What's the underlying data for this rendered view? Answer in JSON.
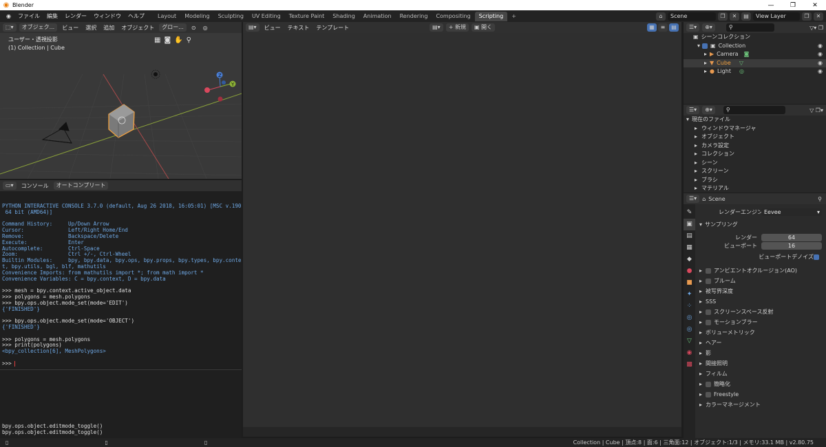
{
  "window": {
    "title": "Blender",
    "minimize": "—",
    "maximize": "❐",
    "close": "✕"
  },
  "menu": [
    "ファイル",
    "編集",
    "レンダー",
    "ウィンドウ",
    "ヘルプ"
  ],
  "workspace_tabs": [
    "Layout",
    "Modeling",
    "Sculpting",
    "UV Editing",
    "Texture Paint",
    "Shading",
    "Animation",
    "Rendering",
    "Compositing",
    "Scripting"
  ],
  "active_tab": "Scripting",
  "scene": {
    "name": "Scene",
    "view_layer": "View Layer"
  },
  "viewport": {
    "header": {
      "mode": "オブジェク...",
      "view": "ビュー",
      "select": "選択",
      "add": "追加",
      "object": "オブジェクト",
      "transform": "グロー..."
    },
    "label_view": "ユーザー・透視投影",
    "label_obj": "(1) Collection | Cube",
    "gizmo": {
      "x": "X",
      "y": "Y",
      "z": "Z"
    }
  },
  "console": {
    "header": {
      "console": "コンソール",
      "autocomplete": "オートコンプリート"
    },
    "lines": [
      {
        "t": "info",
        "s": "PYTHON INTERACTIVE CONSOLE 3.7.0 (default, Aug 26 2018, 16:05:01) [MSC v.1900"
      },
      {
        "t": "info",
        "s": " 64 bit (AMD64)]"
      },
      {
        "t": "blank",
        "s": ""
      },
      {
        "t": "info",
        "s": "Command History:     Up/Down Arrow"
      },
      {
        "t": "info",
        "s": "Cursor:              Left/Right Home/End"
      },
      {
        "t": "info",
        "s": "Remove:              Backspace/Delete"
      },
      {
        "t": "info",
        "s": "Execute:             Enter"
      },
      {
        "t": "info",
        "s": "Autocomplete:        Ctrl-Space"
      },
      {
        "t": "info",
        "s": "Zoom:                Ctrl +/-, Ctrl-Wheel"
      },
      {
        "t": "info",
        "s": "Builtin Modules:     bpy, bpy.data, bpy.ops, bpy.props, bpy.types, bpy.contex"
      },
      {
        "t": "info",
        "s": "t, bpy.utils, bgl, blf, mathutils"
      },
      {
        "t": "info",
        "s": "Convenience Imports: from mathutils import *; from math import *"
      },
      {
        "t": "info",
        "s": "Convenience Variables: C = bpy.context, D = bpy.data"
      },
      {
        "t": "blank",
        "s": ""
      },
      {
        "t": "cmd",
        "s": ">>> mesh = bpy.context.active_object.data"
      },
      {
        "t": "cmd",
        "s": ">>> polygons = mesh.polygons"
      },
      {
        "t": "cmd",
        "s": ">>> bpy.ops.object.mode_set(mode='EDIT')"
      },
      {
        "t": "res",
        "s": "{'FINISHED'}"
      },
      {
        "t": "blank",
        "s": ""
      },
      {
        "t": "cmd",
        "s": ">>> bpy.ops.object.mode_set(mode='OBJECT')"
      },
      {
        "t": "res",
        "s": "{'FINISHED'}"
      },
      {
        "t": "blank",
        "s": ""
      },
      {
        "t": "cmd",
        "s": ">>> polygons = mesh.polygons"
      },
      {
        "t": "cmd",
        "s": ">>> print(polygons)"
      },
      {
        "t": "res",
        "s": "<bpy_collection[6], MeshPolygons>"
      },
      {
        "t": "blank",
        "s": ""
      },
      {
        "t": "cmd",
        "s": ">>> "
      }
    ]
  },
  "info_log": [
    "bpy.ops.object.editmode_toggle()",
    "bpy.ops.object.editmode_toggle()"
  ],
  "text_editor": {
    "view": "ビュー",
    "text": "テキスト",
    "template": "テンプレート",
    "new": "新規",
    "open": "開く"
  },
  "outliner": {
    "root": "シーンコレクション",
    "collection": "Collection",
    "items": [
      "Camera",
      "Cube",
      "Light"
    ]
  },
  "filebrowser": {
    "root": "現在のファイル",
    "items": [
      "ウィンドウマネージャ",
      "オブジェクト",
      "カメラ設定",
      "コレクション",
      "シーン",
      "スクリーン",
      "ブラシ",
      "マテリアル"
    ]
  },
  "properties": {
    "scene": "Scene",
    "engine_label": "レンダーエンジン",
    "engine": "Eevee",
    "sampling": "サンプリング",
    "render_label": "レンダー",
    "render_val": "64",
    "viewport_label": "ビューポート",
    "viewport_val": "16",
    "denoise": "ビューポートデノイズ",
    "panels": [
      {
        "label": "アンビエントオクルージョン(AO)",
        "chk": true
      },
      {
        "label": "ブルーム",
        "chk": true
      },
      {
        "label": "被写界深度",
        "chk": false
      },
      {
        "label": "SSS",
        "chk": false
      },
      {
        "label": "スクリーンスペース反射",
        "chk": true
      },
      {
        "label": "モーションブラー",
        "chk": true
      },
      {
        "label": "ボリューメトリック",
        "chk": false
      },
      {
        "label": "ヘアー",
        "chk": false
      },
      {
        "label": "影",
        "chk": false
      },
      {
        "label": "間接照明",
        "chk": false
      },
      {
        "label": "フィルム",
        "chk": false
      },
      {
        "label": "簡略化",
        "chk": true
      },
      {
        "label": "Freestyle",
        "chk": true
      },
      {
        "label": "カラーマネージメント",
        "chk": false
      }
    ]
  },
  "statusbar": "Collection | Cube | 頂点:8 | 面:6 | 三角面:12 | オブジェクト:1/3 | メモリ:33.1 MB | v2.80.75"
}
